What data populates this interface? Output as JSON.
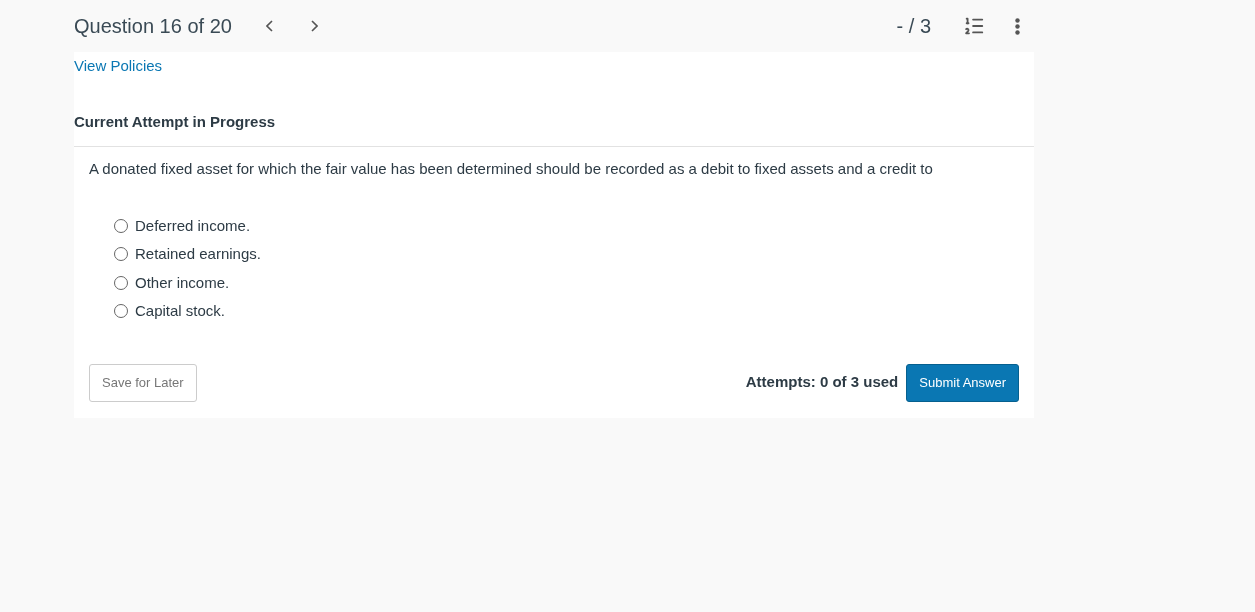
{
  "header": {
    "title": "Question 16 of 20",
    "score": "- / 3"
  },
  "policies_link": "View Policies",
  "attempt_heading": "Current Attempt in Progress",
  "question": "A donated fixed asset for which the fair value has been determined should be recorded as a debit to fixed assets and a credit to",
  "options": [
    {
      "label": "Deferred income.",
      "selected": false
    },
    {
      "label": "Retained earnings.",
      "selected": false
    },
    {
      "label": "Other income.",
      "selected": false
    },
    {
      "label": "Capital stock.",
      "selected": false
    }
  ],
  "save_button": "Save for Later",
  "attempts": "Attempts: 0 of 3 used",
  "submit_button": "Submit Answer"
}
